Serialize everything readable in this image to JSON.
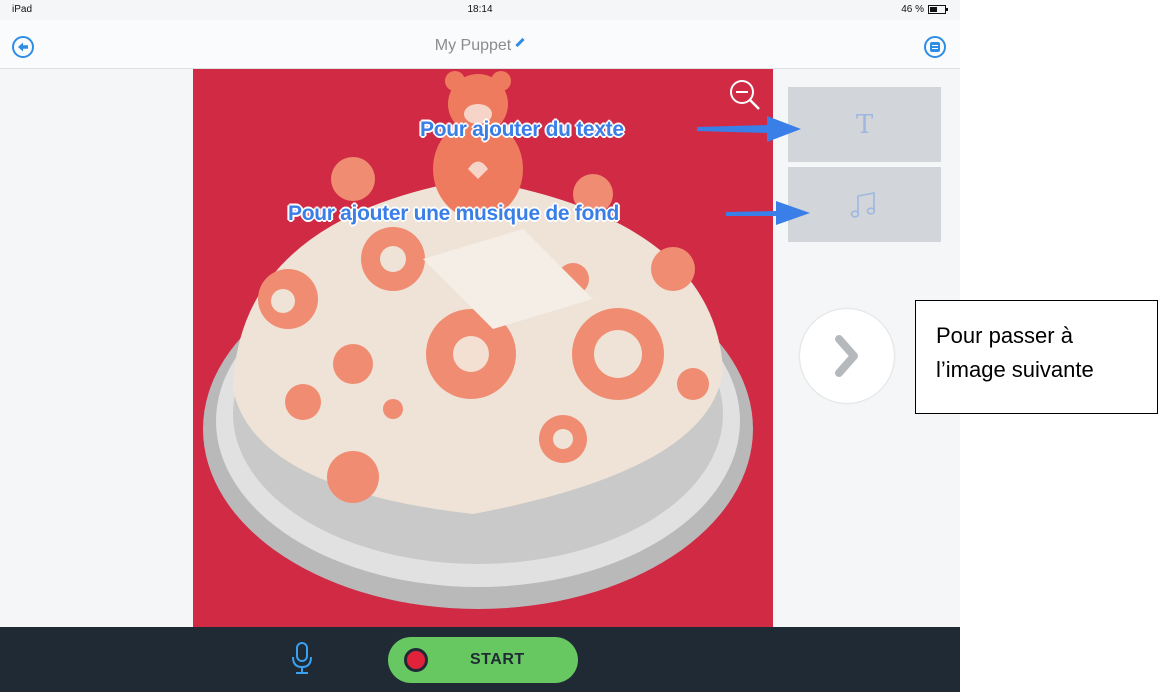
{
  "status_bar": {
    "device": "iPad",
    "time": "18:14",
    "battery": "46 %"
  },
  "nav": {
    "title": "My Puppet"
  },
  "tools": {
    "text_glyph": "T"
  },
  "annotations": {
    "text_hint": "Pour ajouter du texte",
    "music_hint": "Pour ajouter une musique de fond"
  },
  "callout": {
    "line1": "Pour passer à",
    "line2": "l’image suivante"
  },
  "bottom": {
    "start_label": "START"
  },
  "colors": {
    "accent": "#2f8de4",
    "record_green": "#67c862",
    "record_red": "#e0233a",
    "dark_bar": "#1f2a35",
    "photo_bg": "#d02a45"
  }
}
